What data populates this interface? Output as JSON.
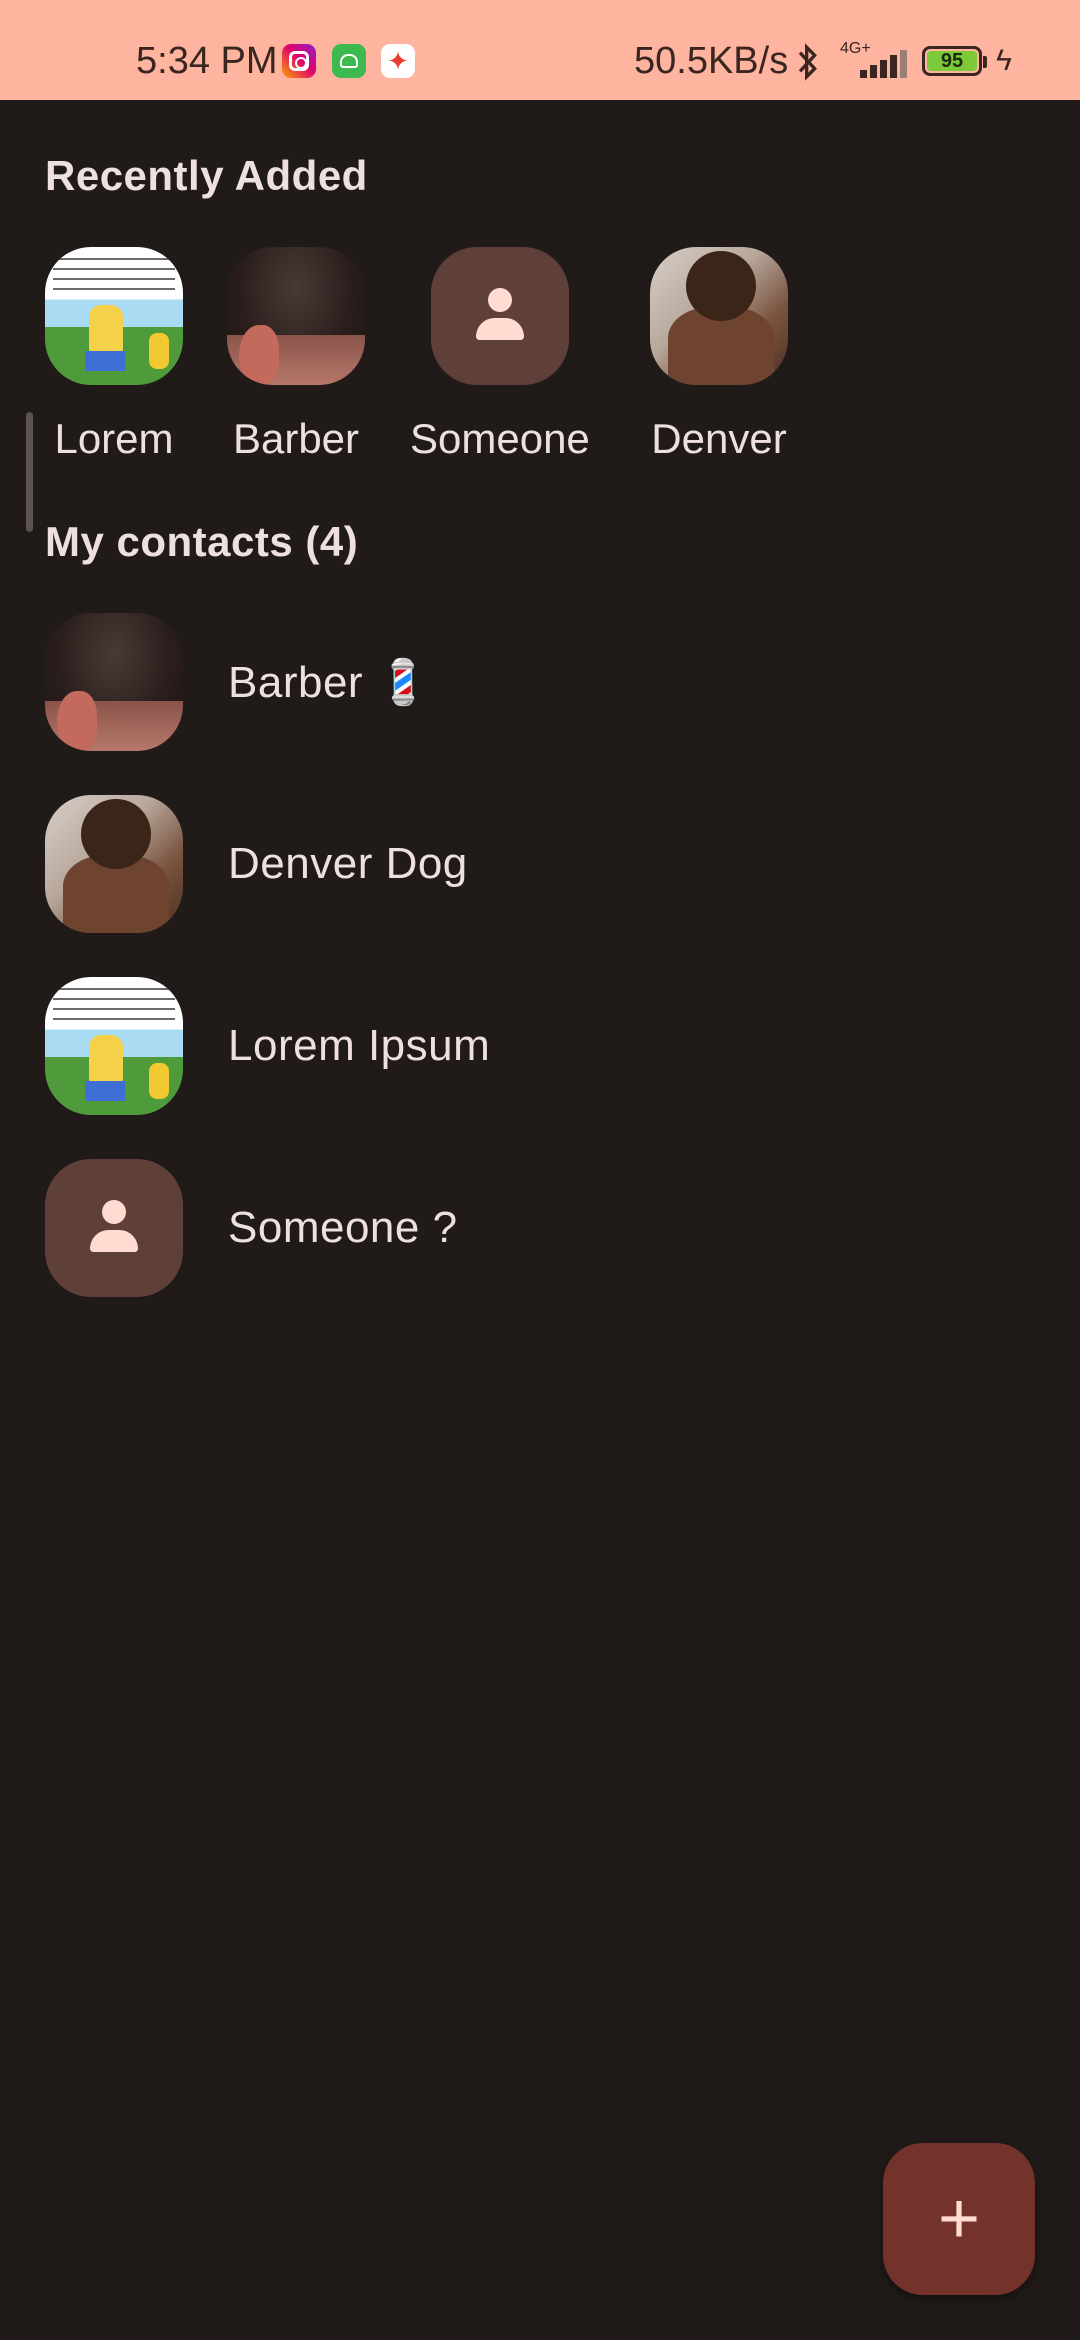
{
  "status_bar": {
    "time": "5:34 PM",
    "net_speed": "50.5KB/s",
    "network_type": "4G+",
    "battery_level": "95",
    "app_icons": [
      "instagram-icon",
      "android-icon",
      "google-play-icon"
    ]
  },
  "recently_added": {
    "title": "Recently Added",
    "items": [
      {
        "name": "Lorem",
        "avatar": "meme"
      },
      {
        "name": "Barber",
        "avatar": "barber"
      },
      {
        "name": "Someone",
        "avatar": "placeholder"
      },
      {
        "name": "Denver",
        "avatar": "dog"
      }
    ]
  },
  "contacts": {
    "title": "My contacts (4)",
    "items": [
      {
        "name": "Barber 💈",
        "avatar": "barber"
      },
      {
        "name": "Denver Dog",
        "avatar": "dog"
      },
      {
        "name": "Lorem Ipsum",
        "avatar": "meme"
      },
      {
        "name": "Someone ?",
        "avatar": "placeholder"
      }
    ]
  },
  "fab": {
    "icon": "add-icon",
    "symbol": "+"
  },
  "colors": {
    "background": "#201a19",
    "status_bar": "#ffb4a0",
    "placeholder_avatar": "#5e4038",
    "fab": "#73332a"
  }
}
